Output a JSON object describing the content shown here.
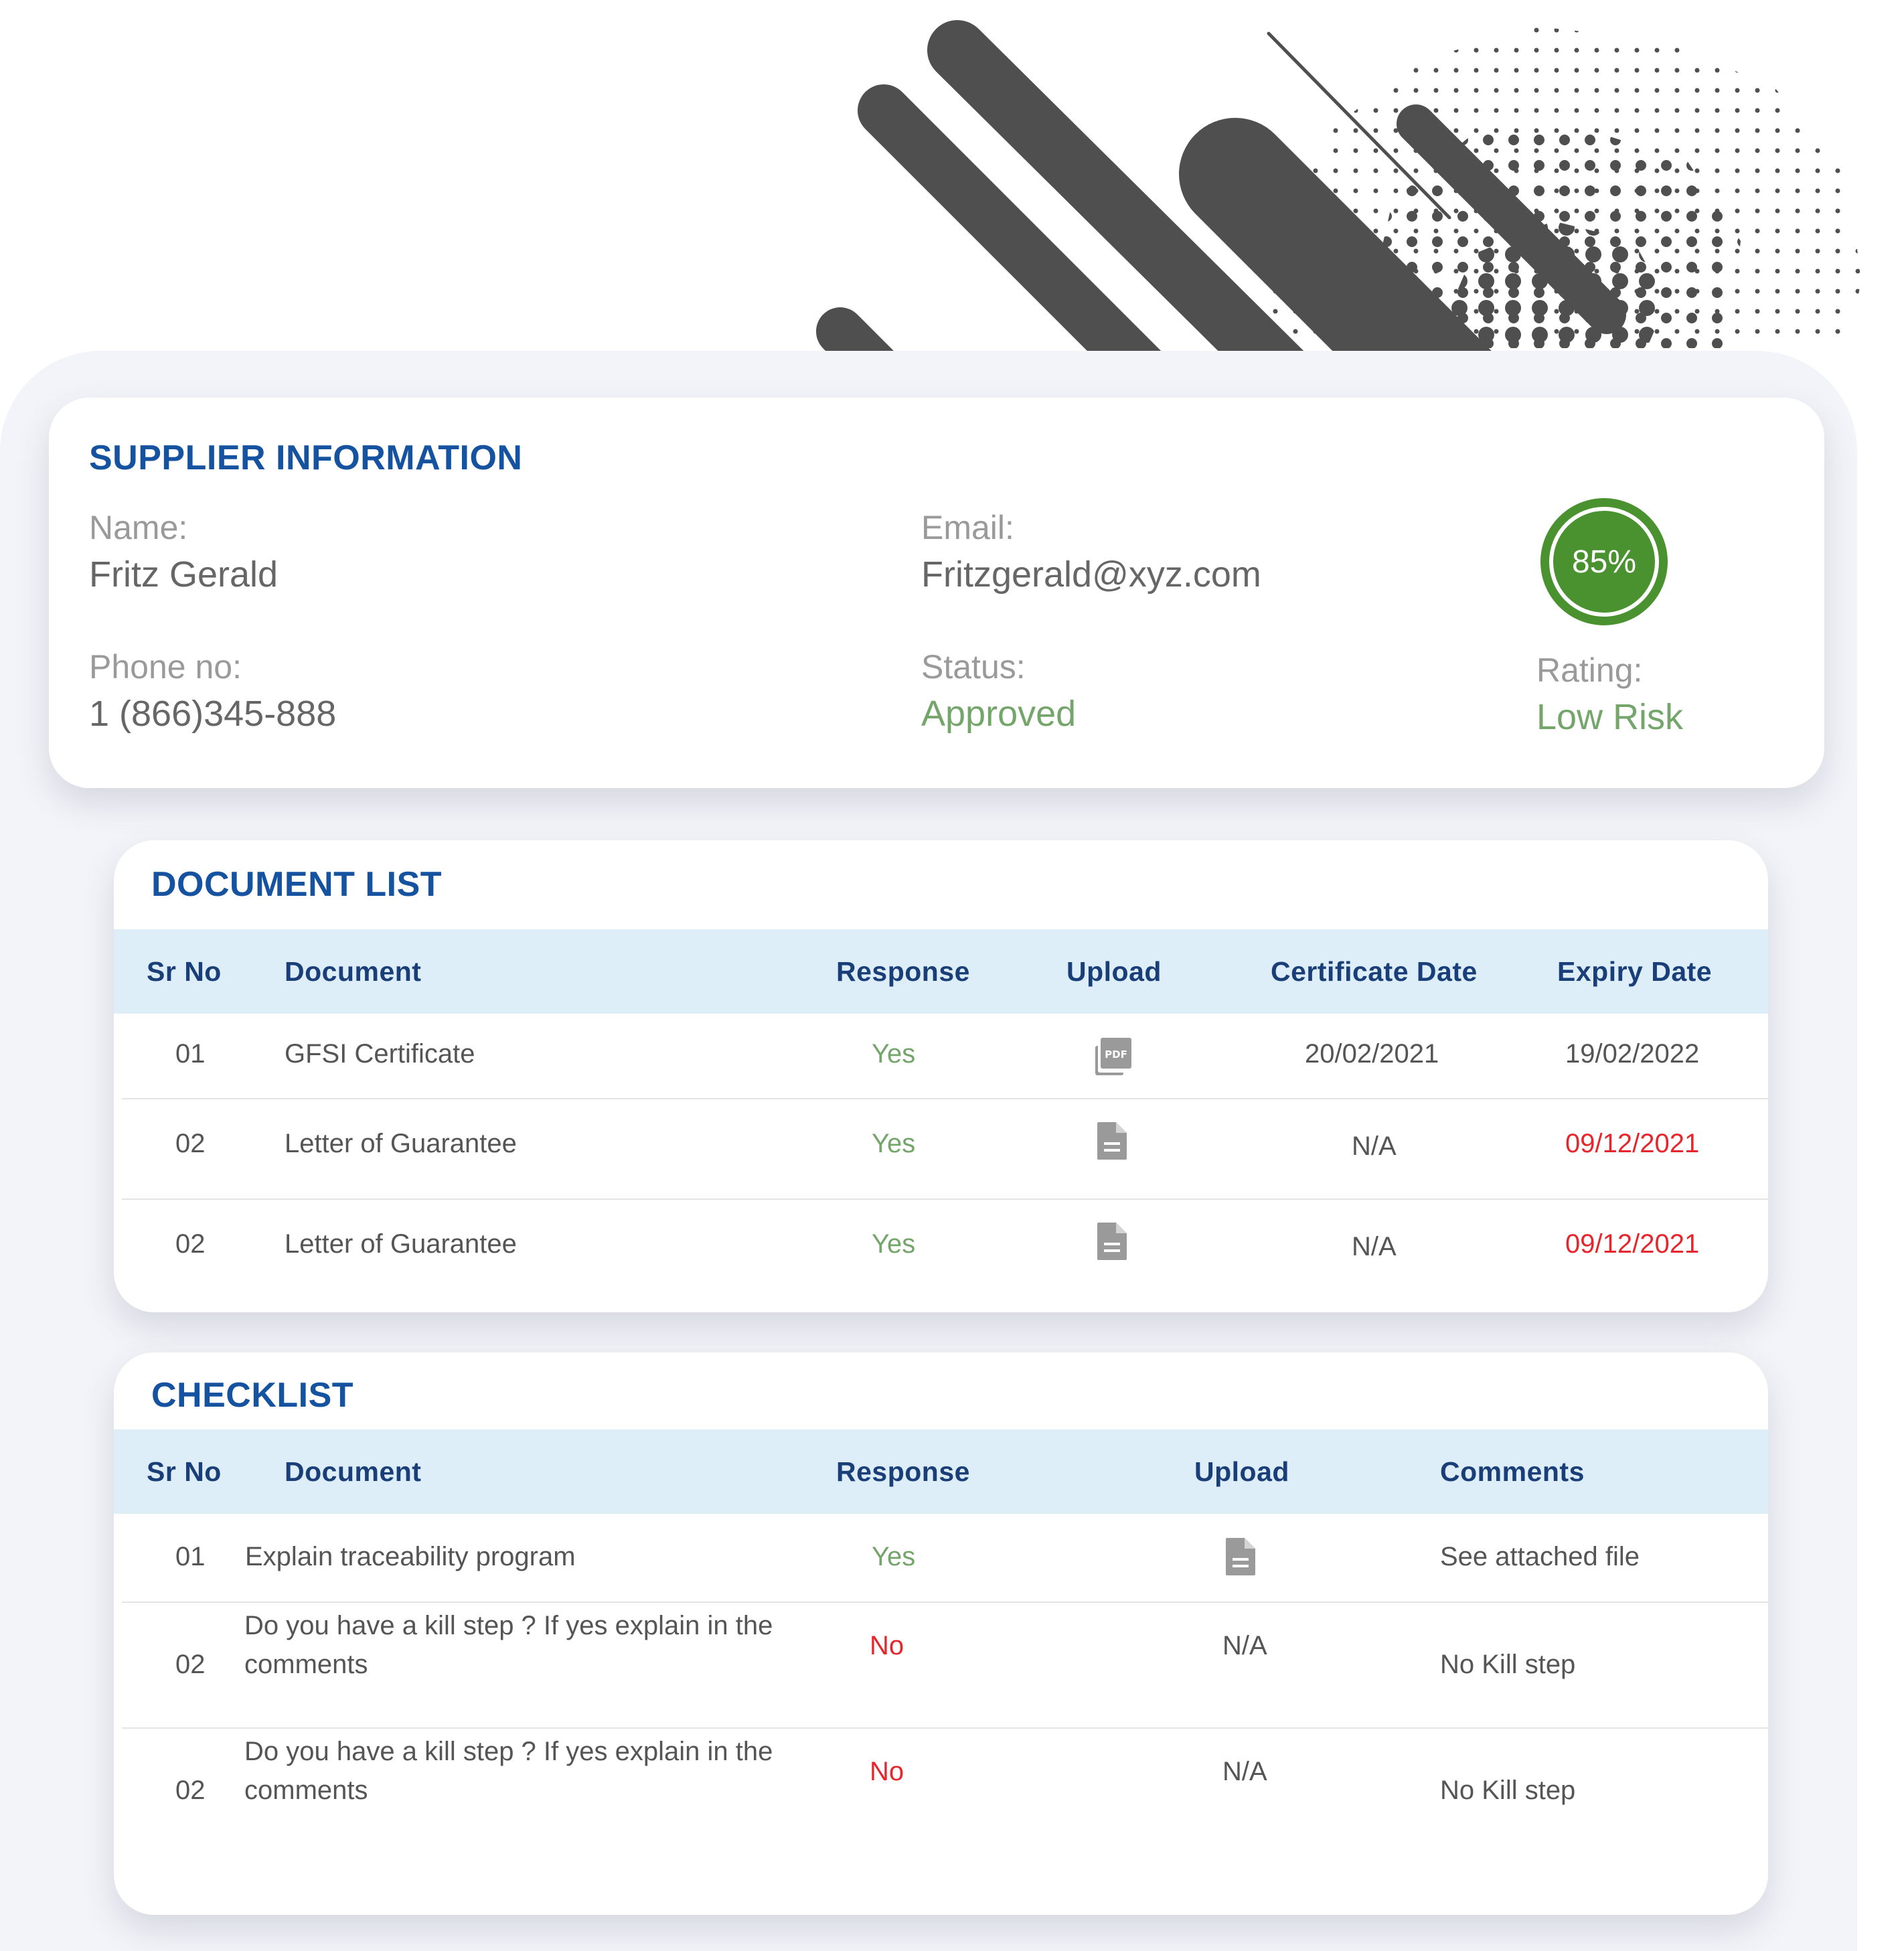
{
  "supplier": {
    "title": "SUPPLIER INFORMATION",
    "name_label": "Name:",
    "name_value": "Fritz Gerald",
    "email_label": "Email:",
    "email_value": "Fritzgerald@xyz.com",
    "phone_label": "Phone no:",
    "phone_value": "1 (866)345-888",
    "status_label": "Status:",
    "status_value": "Approved",
    "score": "85%",
    "rating_label": "Rating:",
    "rating_value": "Low Risk"
  },
  "document_list": {
    "title": "DOCUMENT LIST",
    "headers": [
      "Sr No",
      "Document",
      "Response",
      "Upload",
      "Certificate Date",
      "Expiry Date"
    ],
    "rows": [
      {
        "sr": "01",
        "document": "GFSI Certificate",
        "response": "Yes",
        "upload_icon": "pdf-icon",
        "certificate_date": "20/02/2021",
        "expiry_date": "19/02/2022"
      },
      {
        "sr": "02",
        "document": "Letter of Guarantee",
        "response": "Yes",
        "upload_icon": "document-icon",
        "certificate_date": "N/A",
        "expiry_date": "09/12/2021"
      },
      {
        "sr": "02",
        "document": "Letter of Guarantee",
        "response": "Yes",
        "upload_icon": "document-icon",
        "certificate_date": "N/A",
        "expiry_date": "09/12/2021"
      }
    ]
  },
  "checklist": {
    "title": "CHECKLIST",
    "headers": [
      "Sr No",
      "Document",
      "Response",
      "Upload",
      "Comments"
    ],
    "rows": [
      {
        "sr": "01",
        "document_line1": "Explain traceability program",
        "document_line2": "",
        "response": "Yes",
        "upload": "document-icon",
        "comments": "See attached file"
      },
      {
        "sr": "02",
        "document_line1": "Do you have a kill step ? If yes explain in the",
        "document_line2": "comments",
        "response": "No",
        "upload": "N/A",
        "comments": "No Kill step"
      },
      {
        "sr": "02",
        "document_line1": "Do you have a kill step ? If yes explain in the",
        "document_line2": "comments",
        "response": "No",
        "upload": "N/A",
        "comments": "No Kill step"
      }
    ]
  },
  "colors": {
    "title_blue": "#1552a0",
    "header_bg": "#deeef9",
    "header_text": "#1a3f78",
    "positive_green": "#74a56a",
    "rating_green": "#4a922f",
    "alert_red": "#e6262c",
    "decor_gray": "#4f4f4f"
  }
}
